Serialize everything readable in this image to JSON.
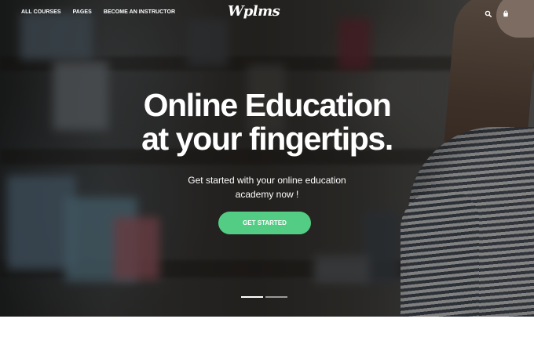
{
  "nav": {
    "items": [
      "ALL COURSES",
      "PAGES",
      "BECOME AN INSTRUCTOR"
    ],
    "logo": "Wplms",
    "icons": [
      "search-icon",
      "cart-icon"
    ]
  },
  "hero": {
    "headline_line_1": "Online Education",
    "headline_line_2": "at your fingertips.",
    "subtitle_line_1": "Get started with your online education",
    "subtitle_line_2": "academy now !",
    "button_label": "GET STARTED",
    "slides": {
      "count": 2,
      "active_index": 0
    }
  },
  "colors": {
    "accent": "#53cd84",
    "text": "#ffffff",
    "page_background": "#ffffff"
  }
}
